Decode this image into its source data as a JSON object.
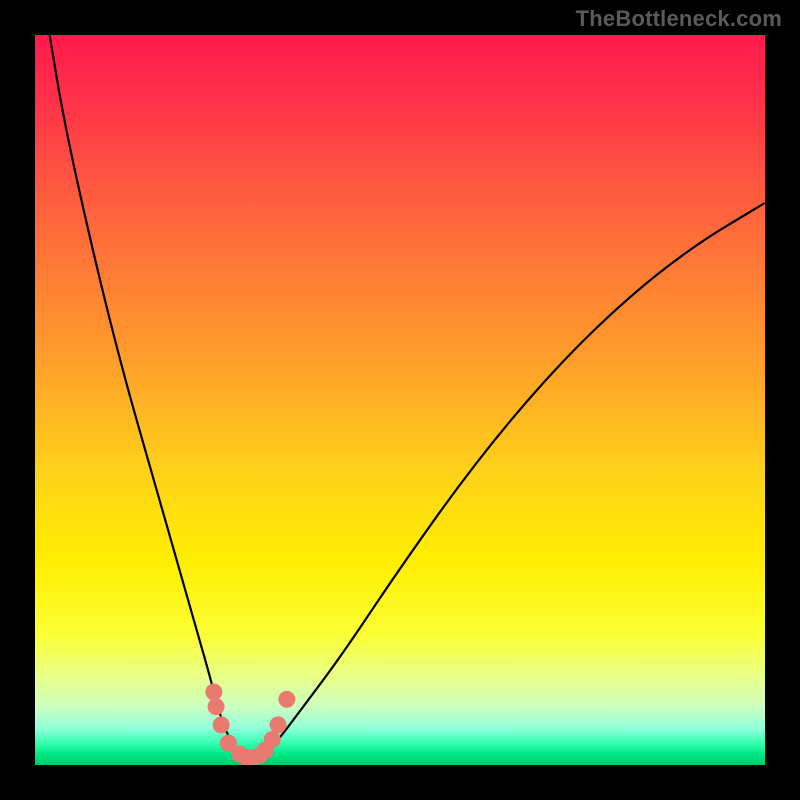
{
  "watermark": "TheBottleneck.com",
  "chart_data": {
    "type": "line",
    "title": "",
    "xlabel": "",
    "ylabel": "",
    "xlim": [
      0,
      100
    ],
    "ylim": [
      0,
      100
    ],
    "series": [
      {
        "name": "curve",
        "x": [
          2,
          4,
          8,
          12,
          16,
          20,
          22,
          24,
          25,
          26,
          27,
          28,
          29,
          30,
          31,
          33,
          36,
          42,
          50,
          60,
          70,
          80,
          90,
          100
        ],
        "values": [
          100,
          88,
          70,
          54,
          40,
          26,
          19,
          12,
          8,
          5,
          3,
          1.5,
          1,
          1,
          1.5,
          3,
          7,
          15,
          27,
          41,
          53,
          63,
          71,
          77
        ]
      }
    ],
    "highlight_points": [
      {
        "x": 24.5,
        "y": 10
      },
      {
        "x": 24.8,
        "y": 8
      },
      {
        "x": 25.5,
        "y": 5.5
      },
      {
        "x": 26.5,
        "y": 3
      },
      {
        "x": 28,
        "y": 1.5
      },
      {
        "x": 29,
        "y": 1
      },
      {
        "x": 30,
        "y": 1
      },
      {
        "x": 30.8,
        "y": 1.3
      },
      {
        "x": 31.5,
        "y": 2
      },
      {
        "x": 32.5,
        "y": 3.5
      },
      {
        "x": 33.3,
        "y": 5.5
      },
      {
        "x": 34.5,
        "y": 9
      }
    ],
    "background_gradient": {
      "top": "#ff1a4d",
      "mid": "#ffee00",
      "bottom": "#00c86a"
    }
  }
}
